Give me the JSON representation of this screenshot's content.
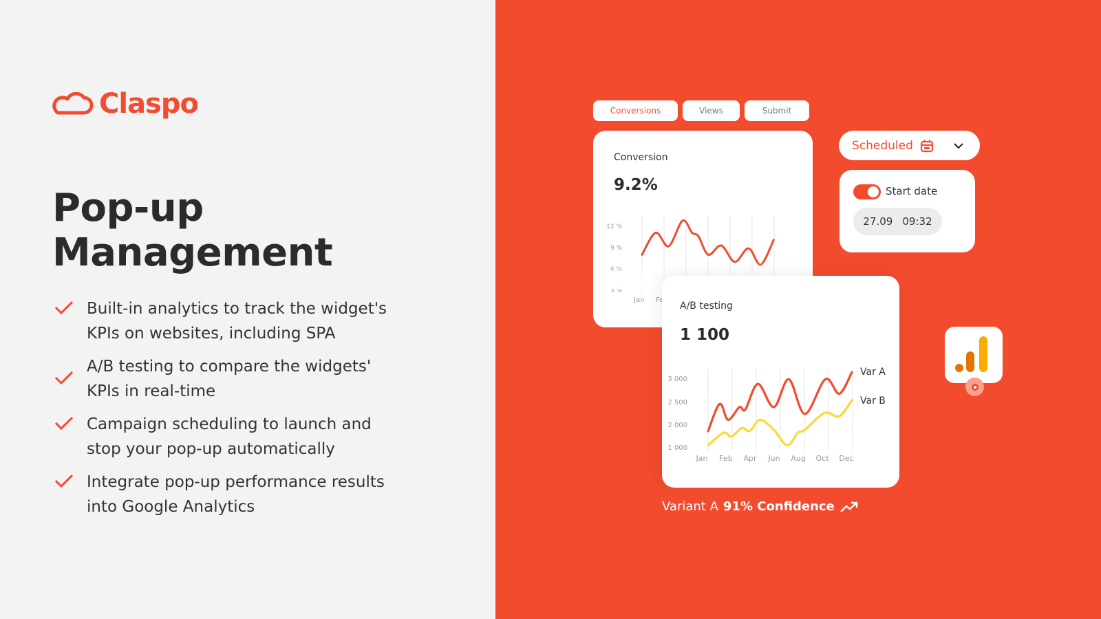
{
  "brand": {
    "name": "Claspo",
    "color": "#f24b2e"
  },
  "hero": {
    "title_lines": [
      "Pop-up",
      "Management"
    ]
  },
  "features": [
    {
      "lines": [
        "Built-in analytics to track the widget's",
        "KPIs on websites, including SPA"
      ]
    },
    {
      "lines": [
        "A/B testing to compare the widgets'",
        "KPIs in real-time"
      ]
    },
    {
      "lines": [
        "Campaign scheduling to launch and",
        "stop your pop-up automatically"
      ]
    },
    {
      "lines": [
        "Integrate pop-up performance results",
        "into Google Analytics"
      ]
    }
  ],
  "tabs": [
    {
      "label": "Conversions",
      "active": true
    },
    {
      "label": "Views",
      "active": false
    },
    {
      "label": "Submit",
      "active": false
    }
  ],
  "conversion_card": {
    "label": "Conversion",
    "value": "9.2%"
  },
  "schedule": {
    "select_value": "Scheduled",
    "icon": "calendar-icon",
    "toggle_on": true,
    "toggle_label": "Start date",
    "date": "27.09",
    "time": "09:32"
  },
  "ab_card": {
    "label": "A/B testing",
    "value": "1 100"
  },
  "confidence": {
    "prefix": "Variant A",
    "strong": "91% Confidence",
    "icon": "trend-up-icon"
  },
  "colors": {
    "accent": "#f24b2e",
    "var_a": "#f24b2e",
    "var_b": "#fdd835",
    "left_bg": "#f3f3f3",
    "ga_orange": "#e37400",
    "ga_yellow": "#f9ab00"
  },
  "chart_data": [
    {
      "type": "line",
      "title": "Conversion",
      "x_ticks": [
        "Jan",
        "Feb"
      ],
      "y_ticks": [
        "12 %",
        "9 %",
        "6 %",
        "3 %"
      ],
      "y_values": [
        12,
        9,
        6,
        3
      ],
      "grid": "vertical",
      "series": [
        {
          "x": [
            0,
            0.62,
            1.21,
            1.84,
            2.27,
            2.56,
            3.01,
            3.6,
            4.21,
            4.84,
            5.39,
            5.98
          ],
          "y": [
            7.9,
            11.0,
            9.1,
            12.7,
            11.0,
            10.5,
            7.9,
            9.2,
            6.9,
            8.8,
            6.5,
            10.0
          ]
        }
      ]
    },
    {
      "type": "line",
      "title": "A/B testing",
      "x_ticks": [
        "Jan",
        "Feb",
        "Apr",
        "Jun",
        "Aug",
        "Oct",
        "Dec"
      ],
      "y_ticks": [
        "3 000",
        "2 500",
        "2 000",
        "1 000"
      ],
      "y_values": [
        3000,
        2500,
        2000,
        1000
      ],
      "grid": "vertical",
      "legend": "right",
      "series": [
        {
          "name": "Var A",
          "x": [
            0,
            0.48,
            0.83,
            1.3,
            1.55,
            2.07,
            2.73,
            3.35,
            4.02,
            4.87,
            5.45,
            5.97
          ],
          "y": [
            1700,
            2450,
            2100,
            2380,
            2330,
            2880,
            2380,
            2980,
            2230,
            2980,
            2670,
            3130
          ]
        },
        {
          "name": "Var B",
          "x": [
            0,
            0.64,
            0.97,
            1.4,
            1.73,
            2.16,
            2.73,
            3.28,
            3.73,
            4.02,
            4.83,
            5.45,
            5.97
          ],
          "y": [
            1080,
            1630,
            1460,
            1840,
            1710,
            2100,
            1760,
            1080,
            1630,
            1760,
            2250,
            2180,
            2530
          ]
        }
      ]
    }
  ]
}
